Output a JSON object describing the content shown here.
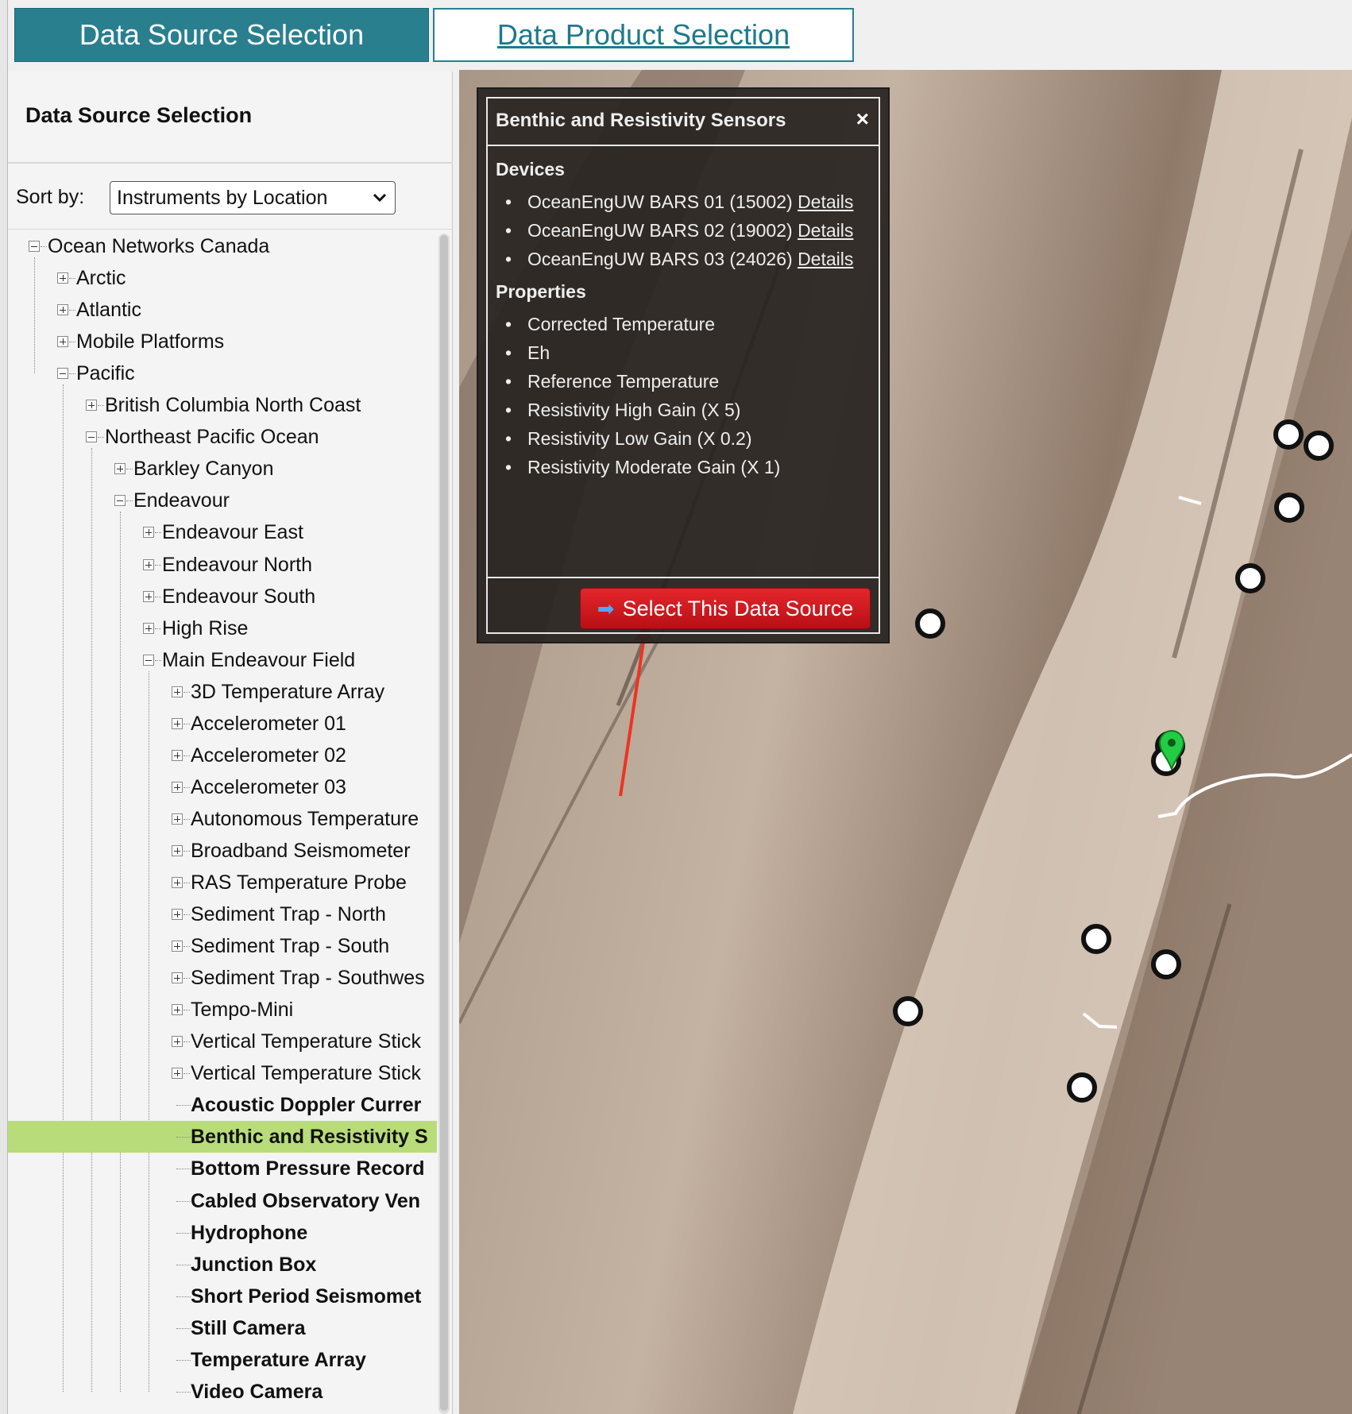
{
  "tabs": {
    "source_label": "Data Source Selection",
    "product_label": "Data Product Selection"
  },
  "left_panel": {
    "title": "Data Source Selection",
    "sort_label": "Sort by:",
    "sort_value": "Instruments by Location"
  },
  "tree": [
    {
      "label": "Ocean Networks Canada",
      "level": 0,
      "state": "expanded"
    },
    {
      "label": "Arctic",
      "level": 1,
      "state": "collapsed"
    },
    {
      "label": "Atlantic",
      "level": 1,
      "state": "collapsed"
    },
    {
      "label": "Mobile Platforms",
      "level": 1,
      "state": "collapsed"
    },
    {
      "label": "Pacific",
      "level": 1,
      "state": "expanded"
    },
    {
      "label": "British Columbia North Coast",
      "level": 2,
      "state": "collapsed"
    },
    {
      "label": "Northeast Pacific Ocean",
      "level": 2,
      "state": "expanded"
    },
    {
      "label": "Barkley Canyon",
      "level": 3,
      "state": "collapsed"
    },
    {
      "label": "Endeavour",
      "level": 3,
      "state": "expanded"
    },
    {
      "label": "Endeavour East",
      "level": 4,
      "state": "collapsed"
    },
    {
      "label": "Endeavour North",
      "level": 4,
      "state": "collapsed"
    },
    {
      "label": "Endeavour South",
      "level": 4,
      "state": "collapsed"
    },
    {
      "label": "High Rise",
      "level": 4,
      "state": "collapsed"
    },
    {
      "label": "Main Endeavour Field",
      "level": 4,
      "state": "expanded"
    },
    {
      "label": "3D Temperature Array",
      "level": 5,
      "state": "collapsed"
    },
    {
      "label": "Accelerometer 01",
      "level": 5,
      "state": "collapsed"
    },
    {
      "label": "Accelerometer 02",
      "level": 5,
      "state": "collapsed"
    },
    {
      "label": "Accelerometer 03",
      "level": 5,
      "state": "collapsed"
    },
    {
      "label": "Autonomous Temperature",
      "level": 5,
      "state": "collapsed"
    },
    {
      "label": "Broadband Seismometer",
      "level": 5,
      "state": "collapsed"
    },
    {
      "label": "RAS Temperature Probe",
      "level": 5,
      "state": "collapsed"
    },
    {
      "label": "Sediment Trap - North",
      "level": 5,
      "state": "collapsed"
    },
    {
      "label": "Sediment Trap - South",
      "level": 5,
      "state": "collapsed"
    },
    {
      "label": "Sediment Trap - Southwes",
      "level": 5,
      "state": "collapsed"
    },
    {
      "label": "Tempo-Mini",
      "level": 5,
      "state": "collapsed"
    },
    {
      "label": "Vertical Temperature Stick",
      "level": 5,
      "state": "collapsed"
    },
    {
      "label": "Vertical Temperature Stick",
      "level": 5,
      "state": "collapsed"
    },
    {
      "label": "Acoustic Doppler Currer",
      "level": 5,
      "state": "leaf"
    },
    {
      "label": "Benthic and Resistivity S",
      "level": 5,
      "state": "leaf",
      "selected": true
    },
    {
      "label": "Bottom Pressure Record",
      "level": 5,
      "state": "leaf"
    },
    {
      "label": "Cabled Observatory Ven",
      "level": 5,
      "state": "leaf"
    },
    {
      "label": "Hydrophone",
      "level": 5,
      "state": "leaf"
    },
    {
      "label": "Junction Box",
      "level": 5,
      "state": "leaf"
    },
    {
      "label": "Short Period Seismomet",
      "level": 5,
      "state": "leaf"
    },
    {
      "label": "Still Camera",
      "level": 5,
      "state": "leaf"
    },
    {
      "label": "Temperature Array",
      "level": 5,
      "state": "leaf"
    },
    {
      "label": "Video Camera",
      "level": 5,
      "state": "leaf"
    }
  ],
  "popup": {
    "title": "Benthic and Resistivity Sensors",
    "close_icon": "×",
    "devices_heading": "Devices",
    "devices": [
      {
        "name": "OceanEngUW BARS 01 (15002)",
        "link": "Details"
      },
      {
        "name": "OceanEngUW BARS 02 (19002)",
        "link": "Details"
      },
      {
        "name": "OceanEngUW BARS 03 (24026)",
        "link": "Details"
      }
    ],
    "properties_heading": "Properties",
    "properties": [
      "Corrected Temperature",
      "Eh",
      "Reference Temperature",
      "Resistivity High Gain (X 5)",
      "Resistivity Low Gain (X 0.2)",
      "Resistivity Moderate Gain (X 1)"
    ],
    "button_label": "Select This Data Source",
    "button_icon": "arrow-right-icon"
  },
  "colors": {
    "tab_active": "#2a7f8f",
    "selected_row": "#b9dc7a",
    "button": "#d9181e",
    "annotation_arrow": "#ee3322",
    "marker_green": "#22cc44"
  }
}
